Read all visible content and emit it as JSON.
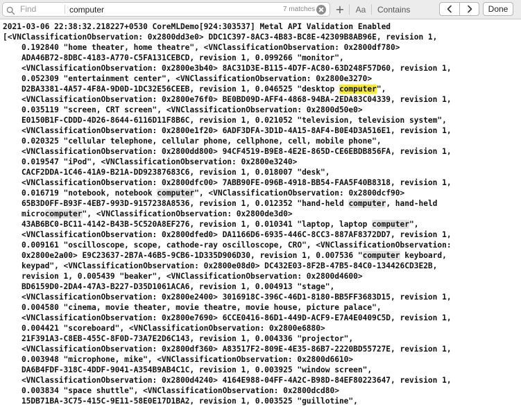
{
  "find_bar": {
    "label": "Find",
    "query": "computer",
    "match_count": "7 matches",
    "case_label": "Aa",
    "mode": "Contains",
    "done_label": "Done",
    "plus_label": "+",
    "icons": {
      "search": "magnifying-glass-icon",
      "clear": "clear-circle-icon",
      "prev": "chevron-left-icon",
      "next": "chevron-right-icon"
    }
  },
  "console": {
    "current_match_index": 0,
    "highlight_color": "#f6e93a",
    "other_match_color": "#e3e3e3",
    "lines": [
      "2021-03-06 22:38:32.218227+0530 CoreMLDemo[924:303537] Metal API Validation Enabled",
      "[<VNClassificationObservation: 0x2800dd3e0> DDC1C397-8AC3-4B83-BC8E-42309B8AB96E, revision 1,",
      "    0.192840 \"home theater, home theatre\", <VNClassificationObservation: 0x2800df780>",
      "    ADA46B72-8DBC-4183-A770-C5FA131CEBCD, revision 1, 0.099266 \"monitor\",",
      "    <VNClassificationObservation: 0x2800e3b40> 8AC31D3E-B115-4D7F-AC80-63D248F57D60, revision 1,",
      "    0.052309 \"entertainment center\", <VNClassificationObservation: 0x2800e3270>",
      "    D2BA3381-4A57-4F8A-9D0D-1DC32E56CEEB, revision 1, 0.046525 \"desktop computer\",",
      "    <VNClassificationObservation: 0x2800e76f0> BE0BD09D-AFF4-4868-94BA-2EDA83C04339, revision 1,",
      "    0.035119 \"screen, CRT screen\", <VNClassificationObservation: 0x2800d50e0>",
      "    E0150B1F-CDDD-4D26-8644-6116D11F8B6C, revision 1, 0.021052 \"television, television system\",",
      "    <VNClassificationObservation: 0x2800e1f20> 6ADF3DFA-3D1D-4A15-8AF4-B0E4D3A516E1, revision 1,",
      "    0.020325 \"cellular telephone, cellular phone, cellphone, cell, mobile phone\",",
      "    <VNClassificationObservation: 0x2800dd800> 94CF4519-B9E8-4E2E-865D-CE6EBDB856FA, revision 1,",
      "    0.019547 \"iPod\", <VNClassificationObservation: 0x2800e3240>",
      "    CACF2DDA-1C46-41A9-B21A-DD92387683C6, revision 1, 0.018007 \"desk\",",
      "    <VNClassificationObservation: 0x2800dfc00> 7ABB90FE-096B-4918-BB54-FAA5F40B8318, revision 1,",
      "    0.016719 \"notebook, notebook computer\", <VNClassificationObservation: 0x2800dcf90>",
      "    65B3D0FF-B93F-4EB7-993D-9157238A8536, revision 1, 0.012352 \"hand-held computer, hand-held",
      "    microcomputer\", <VNClassificationObservation: 0x2800de3d0>",
      "    43AB6BC0-BC11-4142-B43B-5C520A8EF276, revision 1, 0.010341 \"laptop, laptop computer\",",
      "    <VNClassificationObservation: 0x2800dfed0> DA1166D6-6935-446C-8CC3-887AF8372DD7, revision 1,",
      "    0.009161 \"oscilloscope, scope, cathode-ray oscilloscope, CRO\", <VNClassificationObservation:",
      "    0x2800e2a00> E9C23637-2B7A-46B5-9CB6-1D335D906D30, revision 1, 0.007536 \"computer keyboard,",
      "    keypad\", <VNClassificationObservation: 0x2800e08d0> DC432E03-8F2B-47B5-84C0-134426CD3E2B,",
      "    revision 1, 0.005439 \"beaker\", <VNClassificationObservation: 0x2800d4600>",
      "    BD6159D0-2DA4-47A3-B227-D35D1061ACA6, revision 1, 0.004913 \"stage\",",
      "    <VNClassificationObservation: 0x2800e2400> 3016918C-396C-46D1-8180-BB5FF3683D15, revision 1,",
      "    0.004580 \"cinema, movie theater, movie theatre, movie house, picture palace\",",
      "    <VNClassificationObservation: 0x2800e7690> 6CCE0416-86D1-449D-ACF9-E7A4E0409C5D, revision 1,",
      "    0.004421 \"scoreboard\", <VNClassificationObservation: 0x2800e6880>",
      "    21F391A3-C8EB-455C-8F0D-73A7E2D6C143, revision 1, 0.004336 \"projector\",",
      "    <VNClassificationObservation: 0x2800df360> A83517F2-809E-4E35-86B7-2220BD55727E, revision 1,",
      "    0.003948 \"microphone, mike\", <VNClassificationObservation: 0x2800d6610>",
      "    DA6B4FDF-318C-4DDF-9041-A354B9AB4C1C, revision 1, 0.003925 \"window screen\",",
      "    <VNClassificationObservation: 0x2800d4240> 4164E988-04FF-4A2C-B98D-84EF80223647, revision 1,",
      "    0.003834 \"space shuttle\", <VNClassificationObservation: 0x2800dcd80>",
      "    15DB71BA-3C75-415C-9E11-58E0E17D1BA2, revision 1, 0.003525 \"guillotine\","
    ]
  }
}
